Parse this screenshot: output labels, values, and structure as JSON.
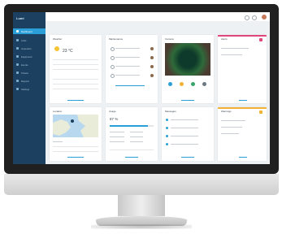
{
  "sidebar": {
    "logo": "Lumi",
    "items": [
      {
        "label": "Dashboard"
      },
      {
        "label": "Units"
      },
      {
        "label": "Inspection"
      },
      {
        "label": "Equipment"
      },
      {
        "label": "Events"
      },
      {
        "label": "Tickets"
      },
      {
        "label": "Reports"
      },
      {
        "label": "Settings"
      }
    ]
  },
  "widgets": {
    "weather": {
      "title": "Weather",
      "temp": "23 °C"
    },
    "maintenance": {
      "title": "Maintenance"
    },
    "camera": {
      "title": "Camera"
    },
    "alerts": {
      "title": "Alerts"
    },
    "map": {
      "title": "Location"
    },
    "energy": {
      "title": "Usage",
      "value": "87 %"
    },
    "messages": {
      "title": "Messages"
    },
    "warnings": {
      "title": "Warnings"
    }
  },
  "colors": {
    "sidebar": "#1c4060",
    "accent": "#2a9fd8",
    "alert": "#e0457b",
    "warning": "#f2b233"
  }
}
